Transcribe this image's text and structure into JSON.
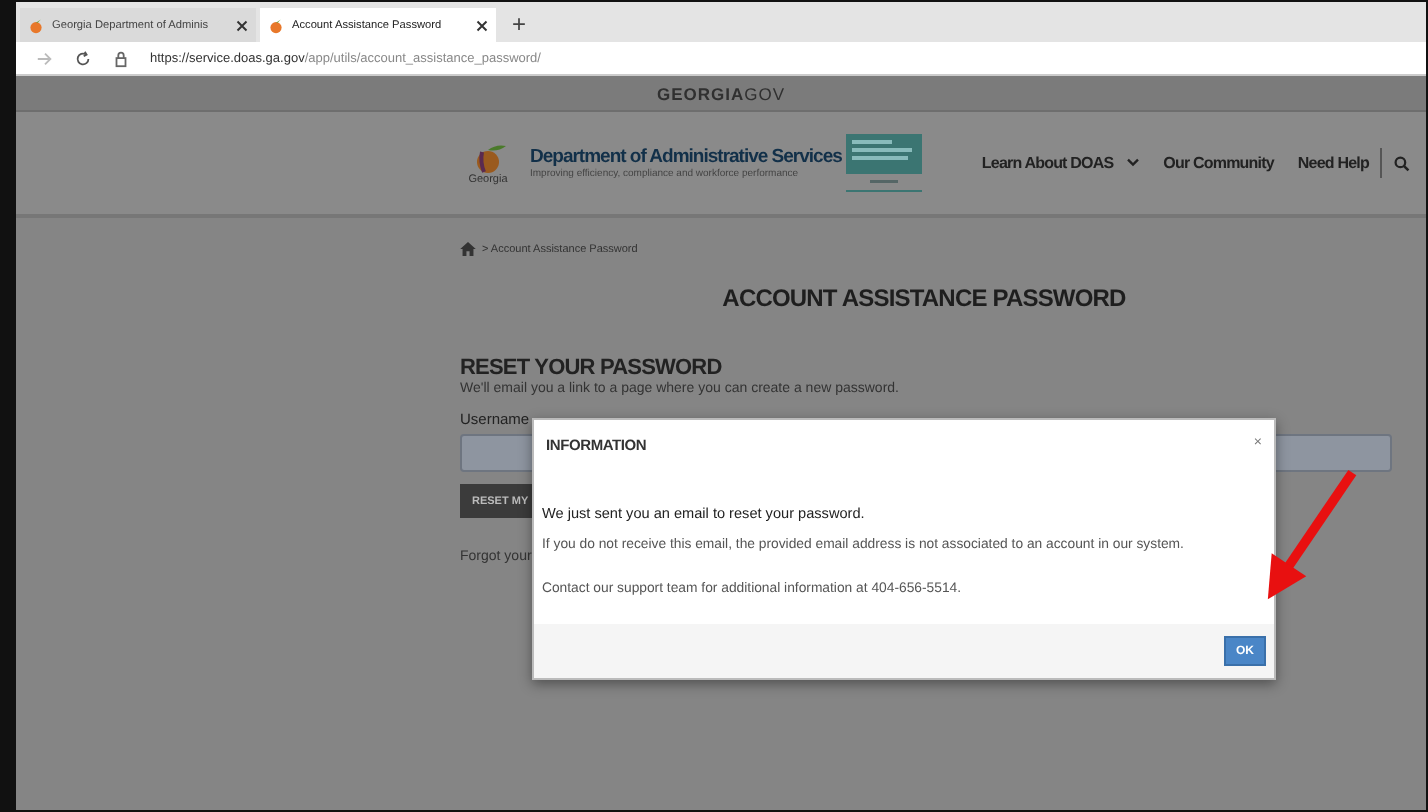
{
  "browser": {
    "tabs": [
      {
        "label": "Georgia Department of Adminis",
        "selected": false
      },
      {
        "label": "Account Assistance Password",
        "selected": true
      }
    ],
    "new_tab": "+",
    "url_host": "https://service.doas.ga.gov",
    "url_path": "/app/utils/account_assistance_password/"
  },
  "top_bar": "**GEORGIA**GOV",
  "header": {
    "logo_text": "Georgia",
    "title": "Department of Administrative Services",
    "tagline": "Improving efficiency, compliance and workforce performance",
    "nav": [
      "Learn About DOAS",
      "Our Community",
      "Need Help"
    ]
  },
  "breadcrumb": "> Account Assistance Password",
  "page_title": "ACCOUNT ASSISTANCE PASSWORD",
  "form": {
    "heading": "RESET YOUR PASSWORD",
    "intro": "We'll email you a link to a page where you can create a new password.",
    "username_label": "Username",
    "button": "RESET MY",
    "forgot": "Forgot your"
  },
  "modal": {
    "title": "INFORMATION",
    "close": "×",
    "lead": "We just sent you an email to reset your password.",
    "body": "If you do not receive this email, the provided email address is not associated to an account in our system.",
    "contact": "Contact our support team for additional information at 404-656-5514.",
    "ok": "OK"
  }
}
